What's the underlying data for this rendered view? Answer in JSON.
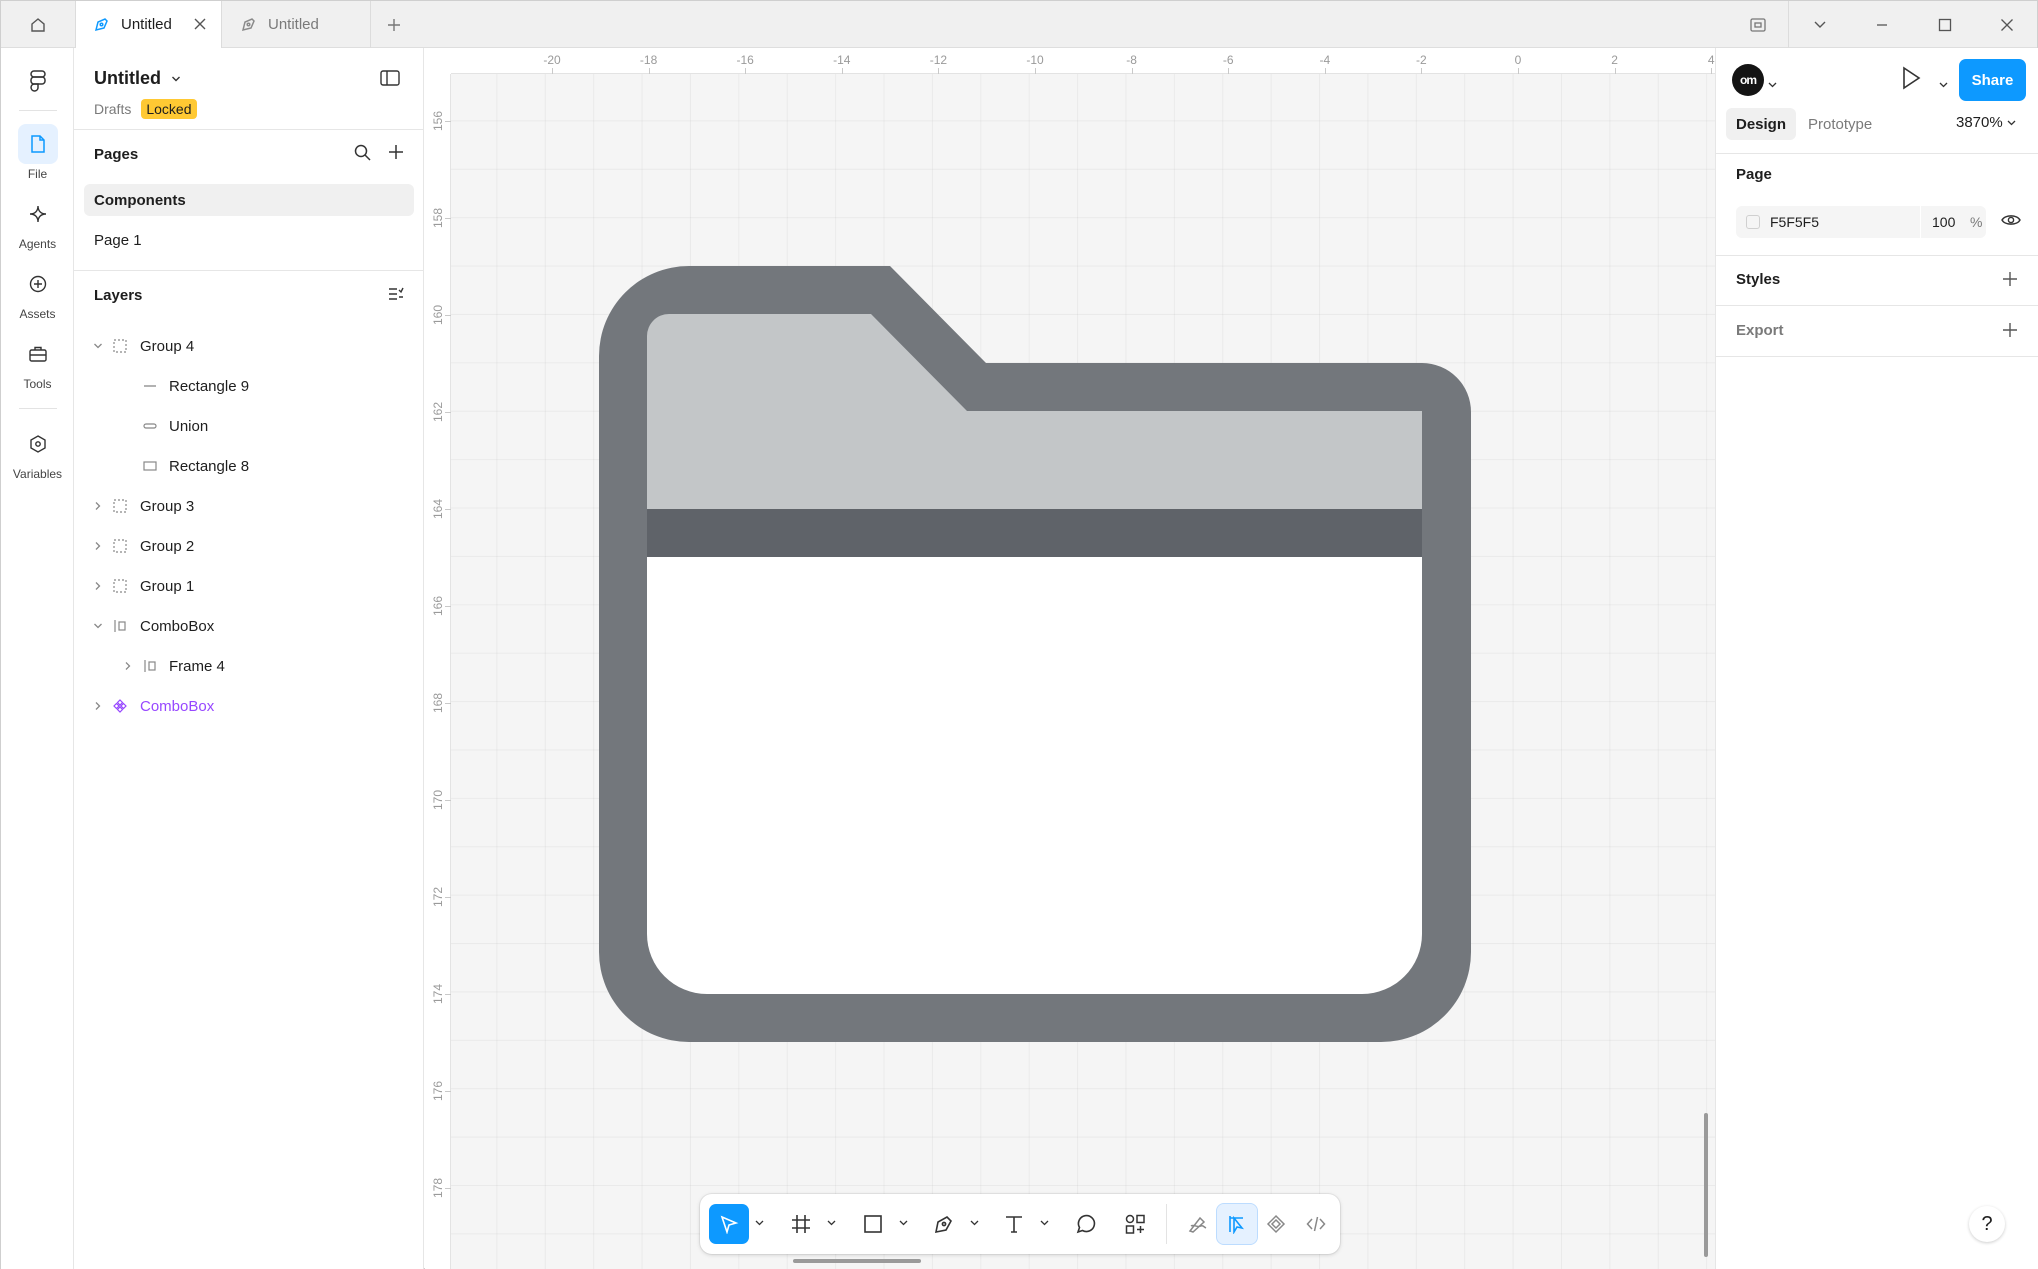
{
  "tabs": [
    {
      "label": "Untitled",
      "active": true
    },
    {
      "label": "Untitled",
      "active": false
    }
  ],
  "rail": [
    {
      "label": "File",
      "icon": "file-icon",
      "active": true
    },
    {
      "label": "Agents",
      "icon": "sparkle-icon",
      "active": false
    },
    {
      "label": "Assets",
      "icon": "assets-icon",
      "active": false
    },
    {
      "label": "Tools",
      "icon": "toolbox-icon",
      "active": false
    },
    {
      "label": "Variables",
      "icon": "variables-icon",
      "active": false
    }
  ],
  "file": {
    "title": "Untitled",
    "location": "Drafts",
    "badge": "Locked"
  },
  "pages": {
    "title": "Pages",
    "items": [
      {
        "label": "Components",
        "selected": true
      },
      {
        "label": "Page 1",
        "selected": false
      }
    ]
  },
  "layers": {
    "title": "Layers",
    "items": [
      {
        "name": "Group 4",
        "type": "group",
        "depth": 0,
        "expanded": true
      },
      {
        "name": "Rectangle 9",
        "type": "line",
        "depth": 1
      },
      {
        "name": "Union",
        "type": "union",
        "depth": 1
      },
      {
        "name": "Rectangle 8",
        "type": "rect",
        "depth": 1
      },
      {
        "name": "Group 3",
        "type": "group",
        "depth": 0,
        "expanded": false
      },
      {
        "name": "Group 2",
        "type": "group",
        "depth": 0,
        "expanded": false
      },
      {
        "name": "Group 1",
        "type": "group",
        "depth": 0,
        "expanded": false
      },
      {
        "name": "ComboBox",
        "type": "frame",
        "depth": 0,
        "expanded": true
      },
      {
        "name": "Frame 4",
        "type": "frame",
        "depth": 1,
        "expanded": false
      },
      {
        "name": "ComboBox",
        "type": "component",
        "depth": 0,
        "expanded": false
      }
    ]
  },
  "rulers": {
    "x": [
      "-20",
      "-18",
      "-16",
      "-14",
      "-12",
      "-10",
      "-8",
      "-6",
      "-4",
      "-2",
      "0",
      "2",
      "4"
    ],
    "y": [
      "156",
      "158",
      "160",
      "162",
      "164",
      "166",
      "168",
      "170",
      "172",
      "174",
      "176",
      "178"
    ]
  },
  "right": {
    "avatar": "om",
    "share_label": "Share",
    "tab_design": "Design",
    "tab_prototype": "Prototype",
    "zoom": "3870%",
    "page_title": "Page",
    "page_fill_hex": "F5F5F5",
    "page_fill_opacity": "100",
    "percent_sign": "%",
    "styles_title": "Styles",
    "export_title": "Export"
  },
  "help_label": "?",
  "colors": {
    "accent": "#0d99ff",
    "folder_outline": "#73777c",
    "folder_tab": "#c3c6c8",
    "folder_band": "#5f6369",
    "canvas_bg": "#f5f5f5",
    "locked_badge": "#ffc933",
    "component": "#9747ff"
  }
}
